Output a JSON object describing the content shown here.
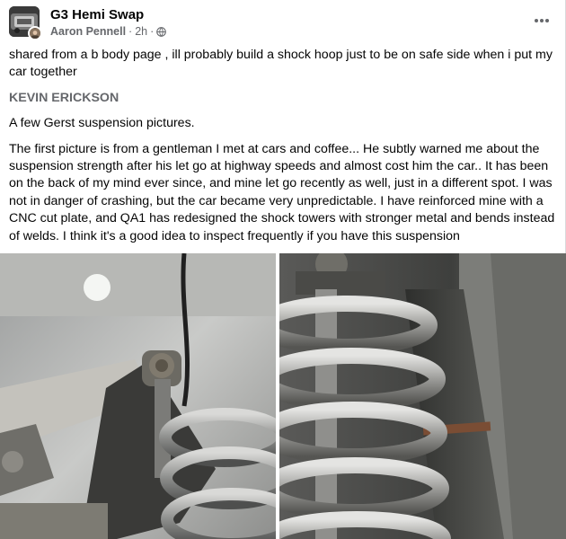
{
  "post": {
    "group_name": "G3 Hemi Swap",
    "author": "Aaron Pennell",
    "time": "2h",
    "separator": "·",
    "more_icon": "more-horizontal-icon",
    "privacy_icon": "globe-icon",
    "paragraphs": [
      "shared from a b body page , ill probably build a shock hoop just to be on safe side when i put my car together",
      "KEVIN ERICKSON",
      "A few Gerst suspension pictures.",
      "The first picture is from a gentleman I met at cars and coffee... He subtly warned me about the suspension strength after his let go at highway speeds and almost cost him the car.. It has been on the back of my mind ever since, and mine let go recently as well, just in a different spot. I was not in danger of crashing, but the car became very unpredictable. I have reinforced mine with a CNC cut plate, and QA1 has redesigned the shock towers with stronger metal and bends instead of welds. I think it's a good idea to inspect frequently if you have this suspension"
    ],
    "photos": [
      "photo-suspension-1",
      "photo-suspension-2"
    ]
  }
}
